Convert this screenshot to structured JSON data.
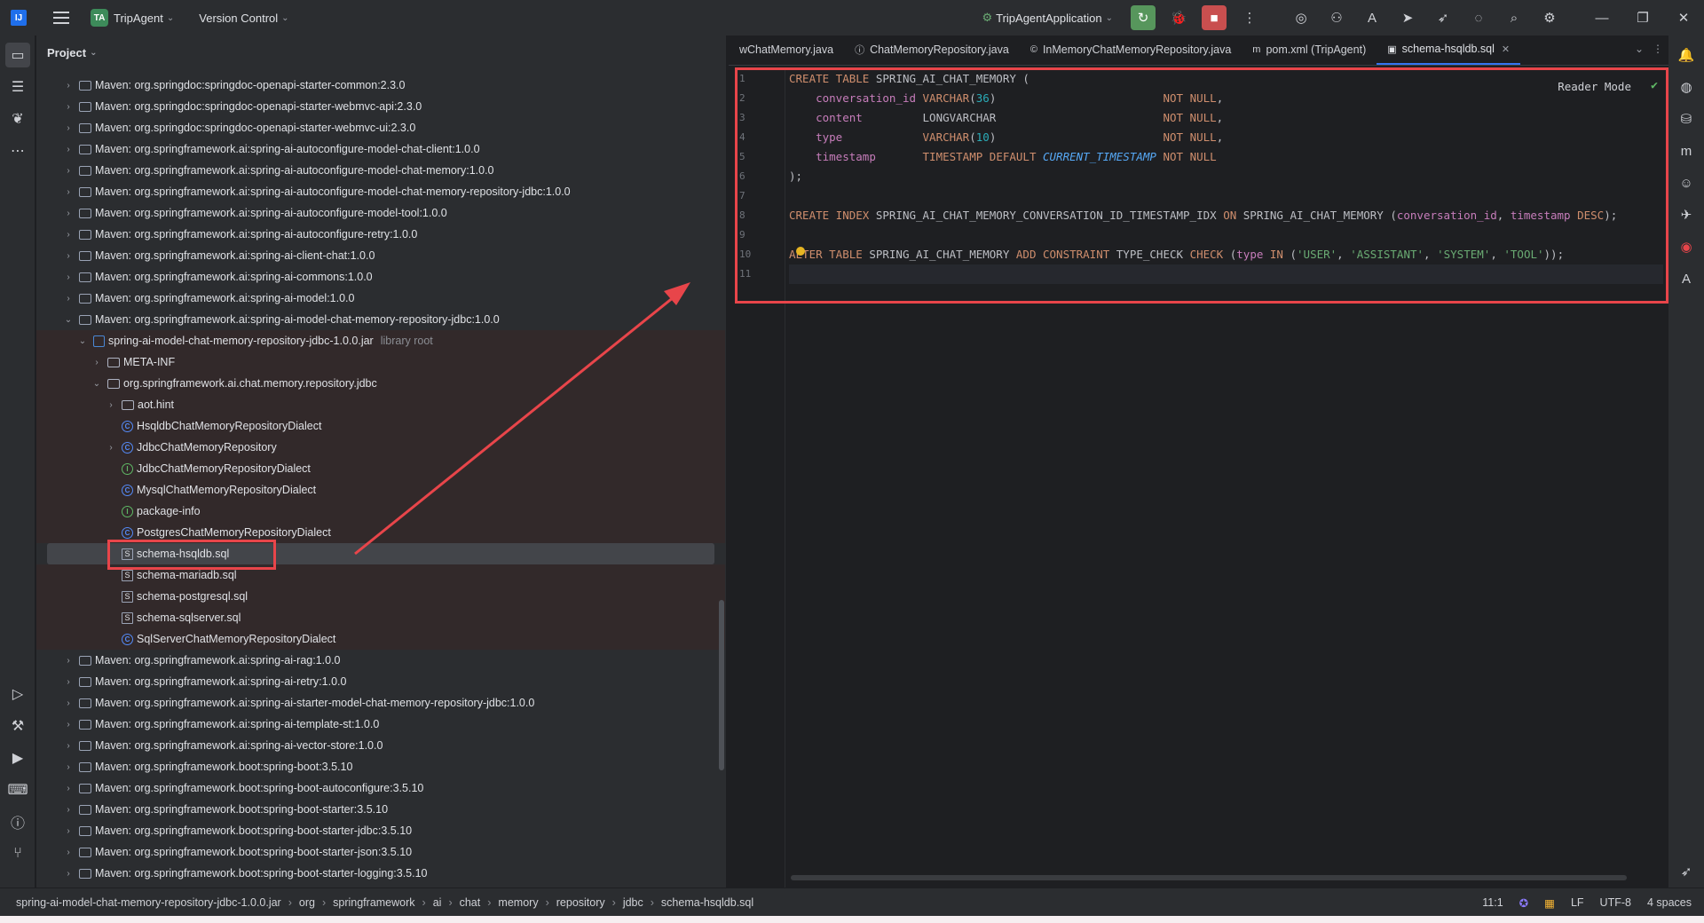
{
  "titlebar": {
    "project_badge": "TA",
    "project_name": "TripAgent",
    "vcs": "Version Control",
    "run_config": "TripAgentApplication"
  },
  "project_panel": {
    "title": "Project",
    "rows": [
      {
        "depth": 1,
        "arrow": "›",
        "icon": "maven",
        "text": "Maven: org.springdoc:springdoc-openapi-starter-common:2.3.0"
      },
      {
        "depth": 1,
        "arrow": "›",
        "icon": "maven",
        "text": "Maven: org.springdoc:springdoc-openapi-starter-webmvc-api:2.3.0"
      },
      {
        "depth": 1,
        "arrow": "›",
        "icon": "maven",
        "text": "Maven: org.springdoc:springdoc-openapi-starter-webmvc-ui:2.3.0"
      },
      {
        "depth": 1,
        "arrow": "›",
        "icon": "maven",
        "text": "Maven: org.springframework.ai:spring-ai-autoconfigure-model-chat-client:1.0.0"
      },
      {
        "depth": 1,
        "arrow": "›",
        "icon": "maven",
        "text": "Maven: org.springframework.ai:spring-ai-autoconfigure-model-chat-memory:1.0.0"
      },
      {
        "depth": 1,
        "arrow": "›",
        "icon": "maven",
        "text": "Maven: org.springframework.ai:spring-ai-autoconfigure-model-chat-memory-repository-jdbc:1.0.0"
      },
      {
        "depth": 1,
        "arrow": "›",
        "icon": "maven",
        "text": "Maven: org.springframework.ai:spring-ai-autoconfigure-model-tool:1.0.0"
      },
      {
        "depth": 1,
        "arrow": "›",
        "icon": "maven",
        "text": "Maven: org.springframework.ai:spring-ai-autoconfigure-retry:1.0.0"
      },
      {
        "depth": 1,
        "arrow": "›",
        "icon": "maven",
        "text": "Maven: org.springframework.ai:spring-ai-client-chat:1.0.0"
      },
      {
        "depth": 1,
        "arrow": "›",
        "icon": "maven",
        "text": "Maven: org.springframework.ai:spring-ai-commons:1.0.0"
      },
      {
        "depth": 1,
        "arrow": "›",
        "icon": "maven",
        "text": "Maven: org.springframework.ai:spring-ai-model:1.0.0"
      },
      {
        "depth": 1,
        "arrow": "⌄",
        "icon": "maven",
        "text": "Maven: org.springframework.ai:spring-ai-model-chat-memory-repository-jdbc:1.0.0"
      },
      {
        "depth": 2,
        "arrow": "⌄",
        "icon": "jar",
        "text": "spring-ai-model-chat-memory-repository-jdbc-1.0.0.jar",
        "muted": "library root",
        "hl": true
      },
      {
        "depth": 3,
        "arrow": "›",
        "icon": "folder",
        "text": "META-INF",
        "hl": true
      },
      {
        "depth": 3,
        "arrow": "⌄",
        "icon": "folder",
        "text": "org.springframework.ai.chat.memory.repository.jdbc",
        "hl": true
      },
      {
        "depth": 4,
        "arrow": "›",
        "icon": "folder",
        "text": "aot.hint",
        "hl": true
      },
      {
        "depth": 4,
        "arrow": "",
        "icon": "cls",
        "text": "HsqldbChatMemoryRepositoryDialect",
        "hl": true
      },
      {
        "depth": 4,
        "arrow": "›",
        "icon": "cls",
        "text": "JdbcChatMemoryRepository",
        "hl": true
      },
      {
        "depth": 4,
        "arrow": "",
        "icon": "iface",
        "text": "JdbcChatMemoryRepositoryDialect",
        "hl": true
      },
      {
        "depth": 4,
        "arrow": "",
        "icon": "cls",
        "text": "MysqlChatMemoryRepositoryDialect",
        "hl": true
      },
      {
        "depth": 4,
        "arrow": "",
        "icon": "iface",
        "text": "package-info",
        "hl": true
      },
      {
        "depth": 4,
        "arrow": "",
        "icon": "cls",
        "text": "PostgresChatMemoryRepositoryDialect",
        "hl": true
      },
      {
        "depth": 4,
        "arrow": "",
        "icon": "sql",
        "text": "schema-hsqldb.sql",
        "sel": true
      },
      {
        "depth": 4,
        "arrow": "",
        "icon": "sql",
        "text": "schema-mariadb.sql",
        "hl": true
      },
      {
        "depth": 4,
        "arrow": "",
        "icon": "sql",
        "text": "schema-postgresql.sql",
        "hl": true
      },
      {
        "depth": 4,
        "arrow": "",
        "icon": "sql",
        "text": "schema-sqlserver.sql",
        "hl": true
      },
      {
        "depth": 4,
        "arrow": "",
        "icon": "cls",
        "text": "SqlServerChatMemoryRepositoryDialect",
        "hl": true
      },
      {
        "depth": 1,
        "arrow": "›",
        "icon": "maven",
        "text": "Maven: org.springframework.ai:spring-ai-rag:1.0.0"
      },
      {
        "depth": 1,
        "arrow": "›",
        "icon": "maven",
        "text": "Maven: org.springframework.ai:spring-ai-retry:1.0.0"
      },
      {
        "depth": 1,
        "arrow": "›",
        "icon": "maven",
        "text": "Maven: org.springframework.ai:spring-ai-starter-model-chat-memory-repository-jdbc:1.0.0"
      },
      {
        "depth": 1,
        "arrow": "›",
        "icon": "maven",
        "text": "Maven: org.springframework.ai:spring-ai-template-st:1.0.0"
      },
      {
        "depth": 1,
        "arrow": "›",
        "icon": "maven",
        "text": "Maven: org.springframework.ai:spring-ai-vector-store:1.0.0"
      },
      {
        "depth": 1,
        "arrow": "›",
        "icon": "maven",
        "text": "Maven: org.springframework.boot:spring-boot:3.5.10"
      },
      {
        "depth": 1,
        "arrow": "›",
        "icon": "maven",
        "text": "Maven: org.springframework.boot:spring-boot-autoconfigure:3.5.10"
      },
      {
        "depth": 1,
        "arrow": "›",
        "icon": "maven",
        "text": "Maven: org.springframework.boot:spring-boot-starter:3.5.10"
      },
      {
        "depth": 1,
        "arrow": "›",
        "icon": "maven",
        "text": "Maven: org.springframework.boot:spring-boot-starter-jdbc:3.5.10"
      },
      {
        "depth": 1,
        "arrow": "›",
        "icon": "maven",
        "text": "Maven: org.springframework.boot:spring-boot-starter-json:3.5.10"
      },
      {
        "depth": 1,
        "arrow": "›",
        "icon": "maven",
        "text": "Maven: org.springframework.boot:spring-boot-starter-logging:3.5.10"
      }
    ]
  },
  "editor": {
    "tabs": [
      {
        "label": "wChatMemory.java",
        "icon": "",
        "active": false
      },
      {
        "label": "ChatMemoryRepository.java",
        "icon": "ⓘ",
        "active": false
      },
      {
        "label": "InMemoryChatMemoryRepository.java",
        "icon": "©",
        "active": false
      },
      {
        "label": "pom.xml (TripAgent)",
        "icon": "m",
        "active": false
      },
      {
        "label": "schema-hsqldb.sql",
        "icon": "▣",
        "active": true
      }
    ],
    "reader_mode": "Reader Mode",
    "line_numbers": [
      "1",
      "2",
      "3",
      "4",
      "5",
      "6",
      "7",
      "8",
      "9",
      "10",
      "11"
    ],
    "lines": [
      [
        [
          "kw",
          "CREATE TABLE "
        ],
        [
          "t",
          "SPRING_AI_CHAT_MEMORY ("
        ]
      ],
      [
        [
          "t",
          "    "
        ],
        [
          "col",
          "conversation_id"
        ],
        [
          "t",
          " "
        ],
        [
          "kw",
          "VARCHAR"
        ],
        [
          "t",
          "("
        ],
        [
          "num",
          "36"
        ],
        [
          "t",
          ")                         "
        ],
        [
          "kw",
          "NOT NULL"
        ],
        [
          "t",
          ","
        ]
      ],
      [
        [
          "t",
          "    "
        ],
        [
          "col",
          "content"
        ],
        [
          "t",
          "         LONGVARCHAR                         "
        ],
        [
          "kw",
          "NOT NULL"
        ],
        [
          "t",
          ","
        ]
      ],
      [
        [
          "t",
          "    "
        ],
        [
          "col",
          "type"
        ],
        [
          "t",
          "            "
        ],
        [
          "kw",
          "VARCHAR"
        ],
        [
          "t",
          "("
        ],
        [
          "num",
          "10"
        ],
        [
          "t",
          ")                         "
        ],
        [
          "kw",
          "NOT NULL"
        ],
        [
          "t",
          ","
        ]
      ],
      [
        [
          "t",
          "    "
        ],
        [
          "col",
          "timestamp"
        ],
        [
          "t",
          "       "
        ],
        [
          "kw",
          "TIMESTAMP DEFAULT "
        ],
        [
          "fn",
          "CURRENT_TIMESTAMP"
        ],
        [
          "t",
          " "
        ],
        [
          "kw",
          "NOT NULL"
        ]
      ],
      [
        [
          "t",
          ");"
        ]
      ],
      [
        [
          "t",
          ""
        ]
      ],
      [
        [
          "kw",
          "CREATE INDEX "
        ],
        [
          "t",
          "SPRING_AI_CHAT_MEMORY_CONVERSATION_ID_TIMESTAMP_IDX "
        ],
        [
          "kw",
          "ON "
        ],
        [
          "t",
          "SPRING_AI_CHAT_MEMORY ("
        ],
        [
          "col",
          "conversation_id"
        ],
        [
          "t",
          ", "
        ],
        [
          "col",
          "timestamp"
        ],
        [
          "t",
          " "
        ],
        [
          "kw",
          "DESC"
        ],
        [
          "t",
          ");"
        ]
      ],
      [
        [
          "t",
          ""
        ]
      ],
      [
        [
          "kw",
          "ALTER TABLE "
        ],
        [
          "t",
          "SPRING_AI_CHAT_MEMORY "
        ],
        [
          "kw",
          "ADD CONSTRAINT "
        ],
        [
          "t",
          "TYPE_CHECK "
        ],
        [
          "kw",
          "CHECK "
        ],
        [
          "t",
          "("
        ],
        [
          "col",
          "type"
        ],
        [
          "t",
          " "
        ],
        [
          "kw",
          "IN "
        ],
        [
          "t",
          "("
        ],
        [
          "str",
          "'USER'"
        ],
        [
          "t",
          ", "
        ],
        [
          "str",
          "'ASSISTANT'"
        ],
        [
          "t",
          ", "
        ],
        [
          "str",
          "'SYSTEM'"
        ],
        [
          "t",
          ", "
        ],
        [
          "str",
          "'TOOL'"
        ],
        [
          "t",
          "));"
        ]
      ],
      [
        [
          "t",
          ""
        ]
      ]
    ]
  },
  "statusbar": {
    "crumbs": [
      "spring-ai-model-chat-memory-repository-jdbc-1.0.0.jar",
      "org",
      "springframework",
      "ai",
      "chat",
      "memory",
      "repository",
      "jdbc",
      "schema-hsqldb.sql"
    ],
    "position": "11:1",
    "line_sep": "LF",
    "encoding": "UTF-8",
    "indent": "4 spaces"
  },
  "colors": {
    "annotation": "#e8454a",
    "accent": "#3574f0"
  }
}
